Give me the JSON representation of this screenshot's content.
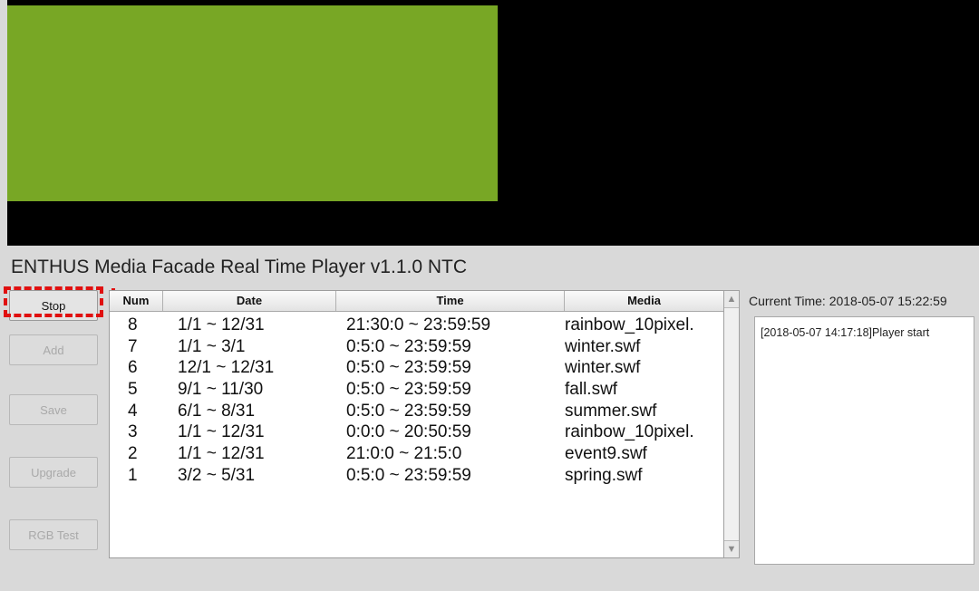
{
  "app": {
    "title": "ENTHUS Media Facade Real Time Player v1.1.0 NTC"
  },
  "preview": {
    "bg_color": "#000000",
    "content_color": "#78a725"
  },
  "buttons": {
    "stop": "Stop",
    "add": "Add",
    "save": "Save",
    "upgrade": "Upgrade",
    "rgb_test": "RGB Test"
  },
  "table": {
    "headers": {
      "num": "Num",
      "date": "Date",
      "time": "Time",
      "media": "Media"
    },
    "rows": [
      {
        "num": "8",
        "date": "1/1 ~ 12/31",
        "time": "21:30:0 ~ 23:59:59",
        "media": "rainbow_10pixel."
      },
      {
        "num": "7",
        "date": "1/1 ~ 3/1",
        "time": "0:5:0 ~ 23:59:59",
        "media": "winter.swf"
      },
      {
        "num": "6",
        "date": "12/1 ~ 12/31",
        "time": "0:5:0 ~ 23:59:59",
        "media": "winter.swf"
      },
      {
        "num": "5",
        "date": "9/1 ~ 11/30",
        "time": "0:5:0 ~ 23:59:59",
        "media": "fall.swf"
      },
      {
        "num": "4",
        "date": "6/1 ~ 8/31",
        "time": "0:5:0 ~ 23:59:59",
        "media": "summer.swf"
      },
      {
        "num": "3",
        "date": "1/1 ~ 12/31",
        "time": "0:0:0 ~ 20:50:59",
        "media": "rainbow_10pixel."
      },
      {
        "num": "2",
        "date": "1/1 ~ 12/31",
        "time": "21:0:0 ~ 21:5:0",
        "media": "event9.swf"
      },
      {
        "num": "1",
        "date": "3/2 ~ 5/31",
        "time": "0:5:0 ~ 23:59:59",
        "media": "spring.swf"
      }
    ]
  },
  "status": {
    "current_time": "Current Time: 2018-05-07 15:22:59"
  },
  "log": {
    "text": "[2018-05-07 14:17:18]Player start"
  },
  "colors": {
    "highlight": "#e01010",
    "panel_bg": "#d9d9d9"
  }
}
